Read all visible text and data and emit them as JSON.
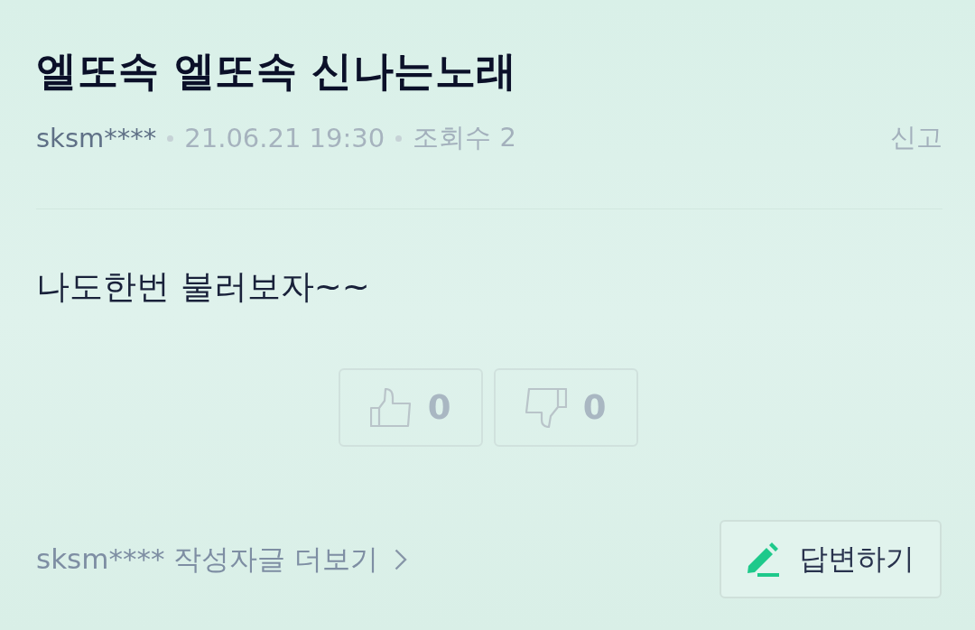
{
  "question": {
    "title": "엘또속 엘또속 신나는노래",
    "author": "sksm****",
    "date": "21.06.21 19:30",
    "views": "조회수 2",
    "report": "신고",
    "body": "나도한번 불러보자~~"
  },
  "votes": [
    {
      "kind": "up",
      "count": "0"
    },
    {
      "kind": "down",
      "count": "0"
    }
  ],
  "footer": {
    "author_link": "sksm**** 작성자글 더보기",
    "answer_button": "답변하기"
  }
}
